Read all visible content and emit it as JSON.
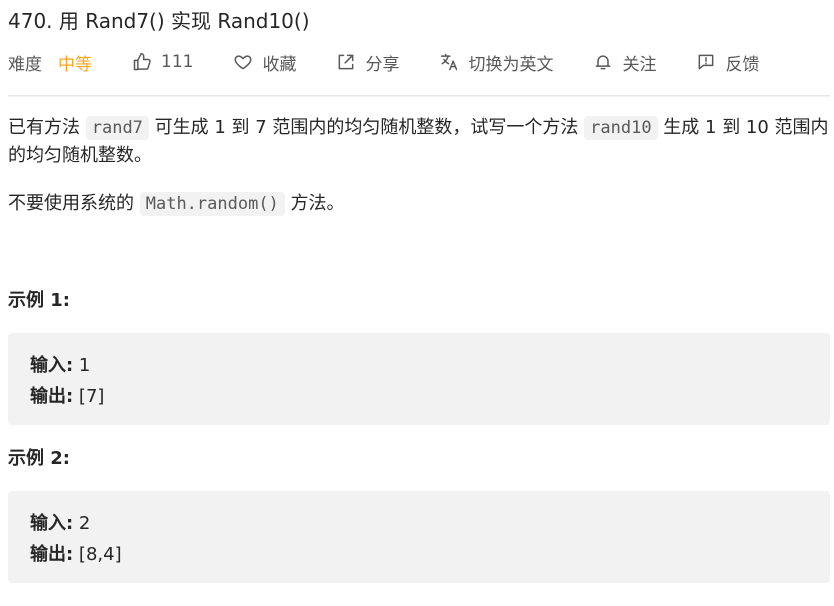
{
  "problem": {
    "title": "470. 用 Rand7() 实现 Rand10()"
  },
  "toolbar": {
    "difficulty_label": "难度",
    "difficulty_value": "中等",
    "like_count": "111",
    "favorite_label": "收藏",
    "share_label": "分享",
    "translate_label": "切换为英文",
    "follow_label": "关注",
    "feedback_label": "反馈",
    "difficulty_color": "#f5a623"
  },
  "description": {
    "p1_part1": "已有方法 ",
    "p1_code1": "rand7",
    "p1_part2": " 可生成 1 到 7 范围内的均匀随机整数，试写一个方法 ",
    "p1_code2": "rand10",
    "p1_part3": " 生成 1 到 10 范围内的均匀随机整数。",
    "p2_part1": "不要使用系统的 ",
    "p2_code": "Math.random()",
    "p2_part2": " 方法。"
  },
  "examples": [
    {
      "title": "示例 1:",
      "input_label": "输入:",
      "input_value": " 1",
      "output_label": "输出:",
      "output_value": " [7]"
    },
    {
      "title": "示例 2:",
      "input_label": "输入:",
      "input_value": " 2",
      "output_label": "输出:",
      "output_value": " [8,4]"
    }
  ]
}
